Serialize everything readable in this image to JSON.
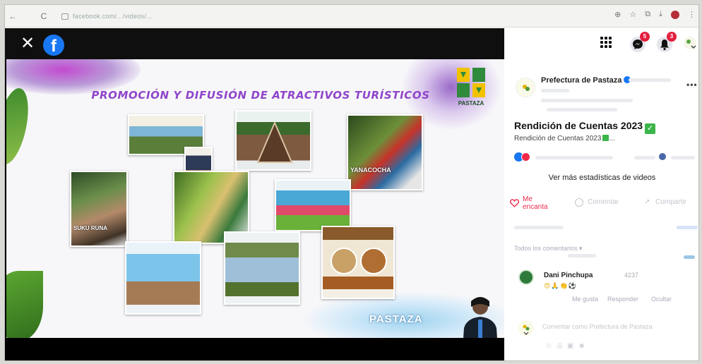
{
  "browser": {
    "url": "facebook.com/.../videos/...",
    "nav_back": "←",
    "nav_reload": "C"
  },
  "video": {
    "close_label": "✕",
    "fb_logo": "f",
    "slide_title": "PROMOCIÓN Y DIFUSIÓN DE ATRACTIVOS TURÍSTICOS",
    "logo_label": "PASTAZA",
    "cards": [
      {
        "caption": ""
      },
      {
        "caption": ""
      },
      {
        "caption": "YANACOCHA"
      },
      {
        "caption": "SUKU RUNA"
      },
      {
        "caption": ""
      },
      {
        "caption": ""
      },
      {
        "caption": ""
      },
      {
        "caption": ""
      },
      {
        "caption": ""
      }
    ],
    "footer_brand": "PASTAZA"
  },
  "topbar": {
    "messenger_badge": "5",
    "notifications_badge": "3"
  },
  "post": {
    "page_name": "Prefectura de Pastaza",
    "title": "Rendición de Cuentas 2023",
    "subtitle": "Rendición de Cuentas 2023",
    "subtitle_more": "...",
    "stats_link": "Ver más estadísticas de videos",
    "like_label": "Me encanta",
    "comment_label": "Comentar",
    "share_label": "Compartir",
    "comments_filter": "Todos los comentarios ▾",
    "comment": {
      "author": "Dani Pinchupa",
      "time": "4237",
      "emojis": "😍🙏👏⚽",
      "like": "Me gusta",
      "reply": "Responder",
      "hide": "Ocultar"
    },
    "write_placeholder": "Comentar como Prefectura de Pastaza"
  },
  "colors": {
    "accent_blue": "#1877f2",
    "slide_title_purple": "#8f45c9",
    "badge_red": "#e41e3f",
    "love_red": "#f0284a",
    "check_green": "#3bb54a"
  }
}
